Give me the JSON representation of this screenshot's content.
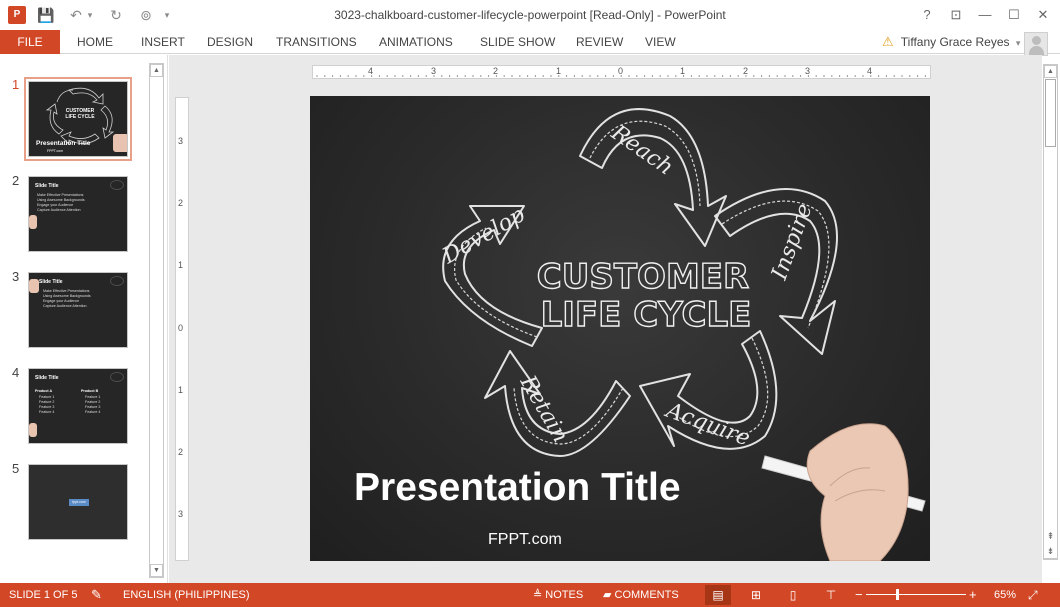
{
  "window": {
    "title": "3023-chalkboard-customer-lifecycle-powerpoint [Read-Only] - PowerPoint",
    "app_icon": "P",
    "help": "?",
    "restore_ribbon": "⊡",
    "minimize": "—",
    "maximize": "☐",
    "close": "✕"
  },
  "qat": {
    "save": "💾",
    "undo": "↶",
    "undo_arrow": "▾",
    "redo": "↻",
    "present": "⊚",
    "customize": "▾"
  },
  "ribbon": {
    "file": "FILE",
    "tabs": [
      "HOME",
      "INSERT",
      "DESIGN",
      "TRANSITIONS",
      "ANIMATIONS",
      "SLIDE SHOW",
      "REVIEW",
      "VIEW"
    ],
    "user": "Tiffany Grace Reyes",
    "user_warning": "⚠",
    "user_menu": "▾"
  },
  "thumbnails": [
    {
      "number": "1",
      "title": "Presentation Title",
      "brand": "FPPT.com",
      "heading": "CUSTOMER LIFE CYCLE"
    },
    {
      "number": "2",
      "title": "Slide Title",
      "bullets": [
        "Make Effective Presentations",
        "Using Awesome Backgrounds",
        "Engage your Audience",
        "Capture Audience Attention"
      ]
    },
    {
      "number": "3",
      "title": "Slide Title",
      "bullets": [
        "Make Effective Presentations",
        "Using Awesome Backgrounds",
        "Engage your Audience",
        "Capture Audience Attention"
      ]
    },
    {
      "number": "4",
      "title": "Slide Title",
      "col_a": "Product A",
      "col_b": "Product B",
      "features": [
        "Feature 1",
        "Feature 2",
        "Feature 3",
        "Feature 4"
      ]
    },
    {
      "number": "5",
      "label": "fppt.com"
    }
  ],
  "ruler": {
    "horizontal": [
      "4",
      "3",
      "2",
      "1",
      "0",
      "1",
      "2",
      "3",
      "4"
    ],
    "vertical": [
      "3",
      "2",
      "1",
      "0",
      "1",
      "2",
      "3"
    ]
  },
  "slide": {
    "heading_line1": "CUSTOMER",
    "heading_line2": "LIFE CYCLE",
    "stages": [
      "Reach",
      "Inspire",
      "Acquire",
      "Retain",
      "Develop"
    ],
    "title": "Presentation Title",
    "brand": "FPPT.com"
  },
  "status": {
    "slide_counter": "SLIDE 1 OF 5",
    "language": "ENGLISH (PHILIPPINES)",
    "notes": "NOTES",
    "comments": "COMMENTS",
    "zoom": "65%",
    "zoom_level_percent": 65
  },
  "colors": {
    "accent": "#d24726",
    "board": "#2a2a2a",
    "chalk": "#e8e8e8"
  }
}
